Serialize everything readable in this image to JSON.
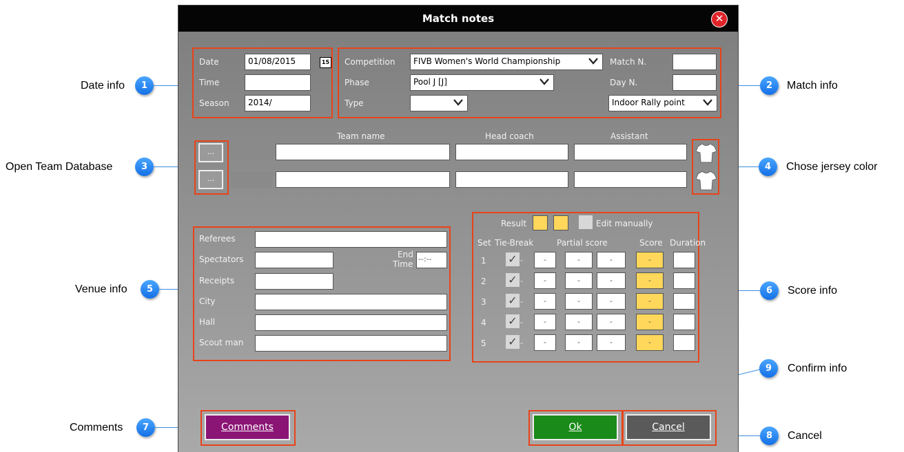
{
  "dialog": {
    "title": "Match notes",
    "close_glyph": "✕"
  },
  "date_info": {
    "date_label": "Date",
    "date_value": "01/08/2015",
    "calendar_glyph": "15",
    "time_label": "Time",
    "time_value": "",
    "season_label": "Season",
    "season_value": "2014/"
  },
  "match_info": {
    "competition_label": "Competition",
    "competition_value": "FIVB Women's World Championship",
    "phase_label": "Phase",
    "phase_value": "Pool J [J]",
    "type_label": "Type",
    "type_value": "",
    "match_n_label": "Match N.",
    "match_n_value": "",
    "day_n_label": "Day N.",
    "day_n_value": "",
    "scoring_value": "Indoor Rally point"
  },
  "teams": {
    "open_glyph": "...",
    "col_team": "Team name",
    "col_coach": "Head coach",
    "col_assistant": "Assistant",
    "rows": [
      {
        "team": "",
        "coach": "",
        "assistant": ""
      },
      {
        "team": "",
        "coach": "",
        "assistant": ""
      }
    ]
  },
  "venue": {
    "referees_label": "Referees",
    "spectators_label": "Spectators",
    "end_label": "End",
    "time_label": "Time",
    "end_time_value": "--:--",
    "receipts_label": "Receipts",
    "city_label": "City",
    "hall_label": "Hall",
    "scout_label": "Scout man"
  },
  "score": {
    "result_label": "Result",
    "edit_manually_label": "Edit manually",
    "col_set": "Set",
    "col_tiebreak": "Tie-Break",
    "col_partial": "Partial score",
    "col_score": "Score",
    "col_duration": "Duration",
    "dash": "-",
    "check_glyph": "✓",
    "sets": [
      "1",
      "2",
      "3",
      "4",
      "5"
    ]
  },
  "buttons": {
    "comments": "Comments",
    "ok": "Ok",
    "cancel": "Cancel"
  },
  "callouts": [
    {
      "num": "1",
      "text": "Date info"
    },
    {
      "num": "2",
      "text": "Match info"
    },
    {
      "num": "3",
      "text": "Open Team Database"
    },
    {
      "num": "4",
      "text": "Chose jersey color"
    },
    {
      "num": "5",
      "text": "Venue info"
    },
    {
      "num": "6",
      "text": "Score info"
    },
    {
      "num": "7",
      "text": "Comments"
    },
    {
      "num": "8",
      "text": "Cancel"
    },
    {
      "num": "9",
      "text": "Confirm info"
    }
  ],
  "colors": {
    "highlight": "#e8431a",
    "comments_button": "#8b1575",
    "ok_button": "#1a8a1a",
    "cancel_button": "#5a5a5a",
    "callout_badge": "#2a86f0",
    "score_yellow": "#ffd75a"
  }
}
